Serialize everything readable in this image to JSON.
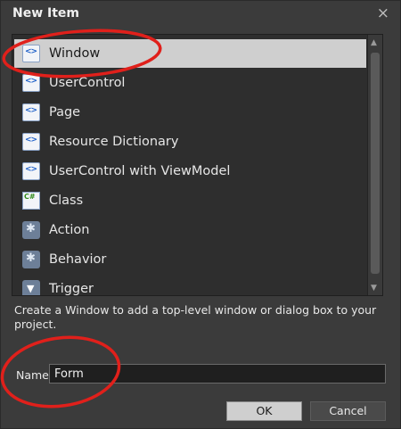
{
  "dialog": {
    "title": "New Item",
    "close_glyph": "×"
  },
  "items": [
    {
      "label": "Window",
      "icon": "xaml-document-icon",
      "selected": true
    },
    {
      "label": "UserControl",
      "icon": "xaml-document-icon"
    },
    {
      "label": "Page",
      "icon": "xaml-document-icon"
    },
    {
      "label": "Resource Dictionary",
      "icon": "xaml-document-icon"
    },
    {
      "label": "UserControl with ViewModel",
      "icon": "xaml-document-icon"
    },
    {
      "label": "Class",
      "icon": "csharp-class-icon"
    },
    {
      "label": "Action",
      "icon": "action-icon"
    },
    {
      "label": "Behavior",
      "icon": "behavior-icon"
    },
    {
      "label": "Trigger",
      "icon": "trigger-icon"
    }
  ],
  "description": "Create a Window to add a top-level window or dialog box to your project.",
  "name_field": {
    "label": "Name",
    "value": "Form"
  },
  "buttons": {
    "ok": "OK",
    "cancel": "Cancel"
  },
  "scrollbar": {
    "up": "▲",
    "down": "▼"
  },
  "colors": {
    "annotation": "#e0201b",
    "selection": "#cfcfcf",
    "background": "#3b3b3b"
  }
}
